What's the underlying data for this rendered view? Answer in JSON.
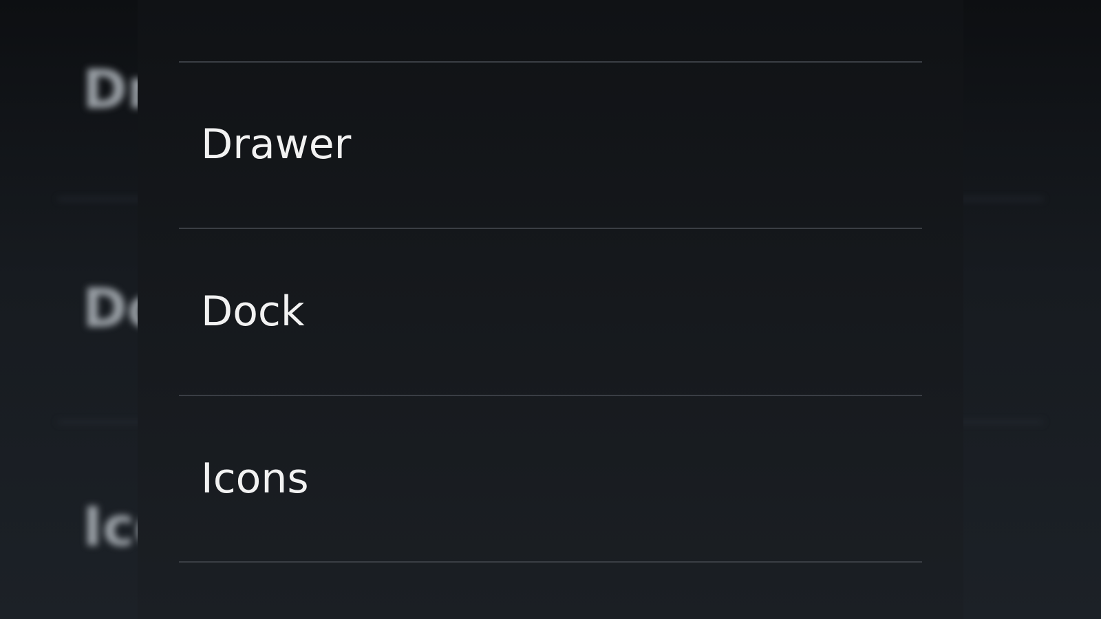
{
  "background_list": {
    "items": [
      {
        "label": "Drawer"
      },
      {
        "label": "Dock"
      },
      {
        "label": "Icons"
      }
    ]
  },
  "menu": {
    "items": [
      {
        "label": "Drawer"
      },
      {
        "label": "Dock"
      },
      {
        "label": "Icons"
      },
      {
        "label": ""
      }
    ]
  }
}
